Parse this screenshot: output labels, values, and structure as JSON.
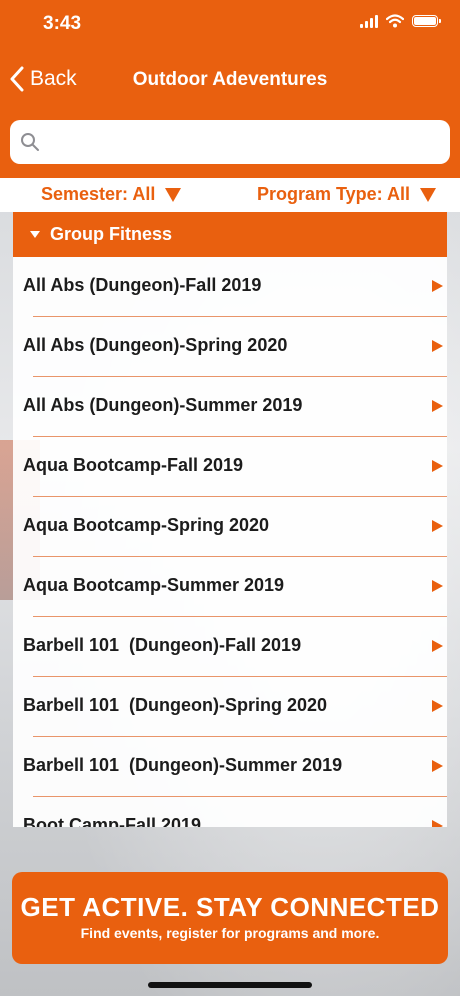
{
  "status": {
    "time": "3:43"
  },
  "nav": {
    "back_label": "Back",
    "title": "Outdoor Adeventures"
  },
  "search": {
    "placeholder": "",
    "value": ""
  },
  "filters": {
    "semester_label": "Semester: All",
    "program_type_label": "Program Type: All"
  },
  "section": {
    "title": "Group Fitness"
  },
  "items": [
    {
      "label": "All Abs (Dungeon)-Fall 2019"
    },
    {
      "label": "All Abs (Dungeon)-Spring 2020"
    },
    {
      "label": "All Abs (Dungeon)-Summer 2019"
    },
    {
      "label": "Aqua Bootcamp-Fall 2019"
    },
    {
      "label": "Aqua Bootcamp-Spring 2020"
    },
    {
      "label": "Aqua Bootcamp-Summer 2019"
    },
    {
      "label": "Barbell 101  (Dungeon)-Fall 2019"
    },
    {
      "label": "Barbell 101  (Dungeon)-Spring 2020"
    },
    {
      "label": "Barbell 101  (Dungeon)-Summer 2019"
    },
    {
      "label": "Boot Camp-Fall 2019"
    }
  ],
  "banner": {
    "title": "GET ACTIVE.  STAY CONNECTED",
    "subtitle": "Find events, register for programs and more."
  },
  "colors": {
    "accent": "#e9600f"
  },
  "icons": {
    "back": "chevron-left-icon",
    "search": "search-icon",
    "filter": "triangle-down-icon",
    "row": "triangle-right-icon"
  }
}
